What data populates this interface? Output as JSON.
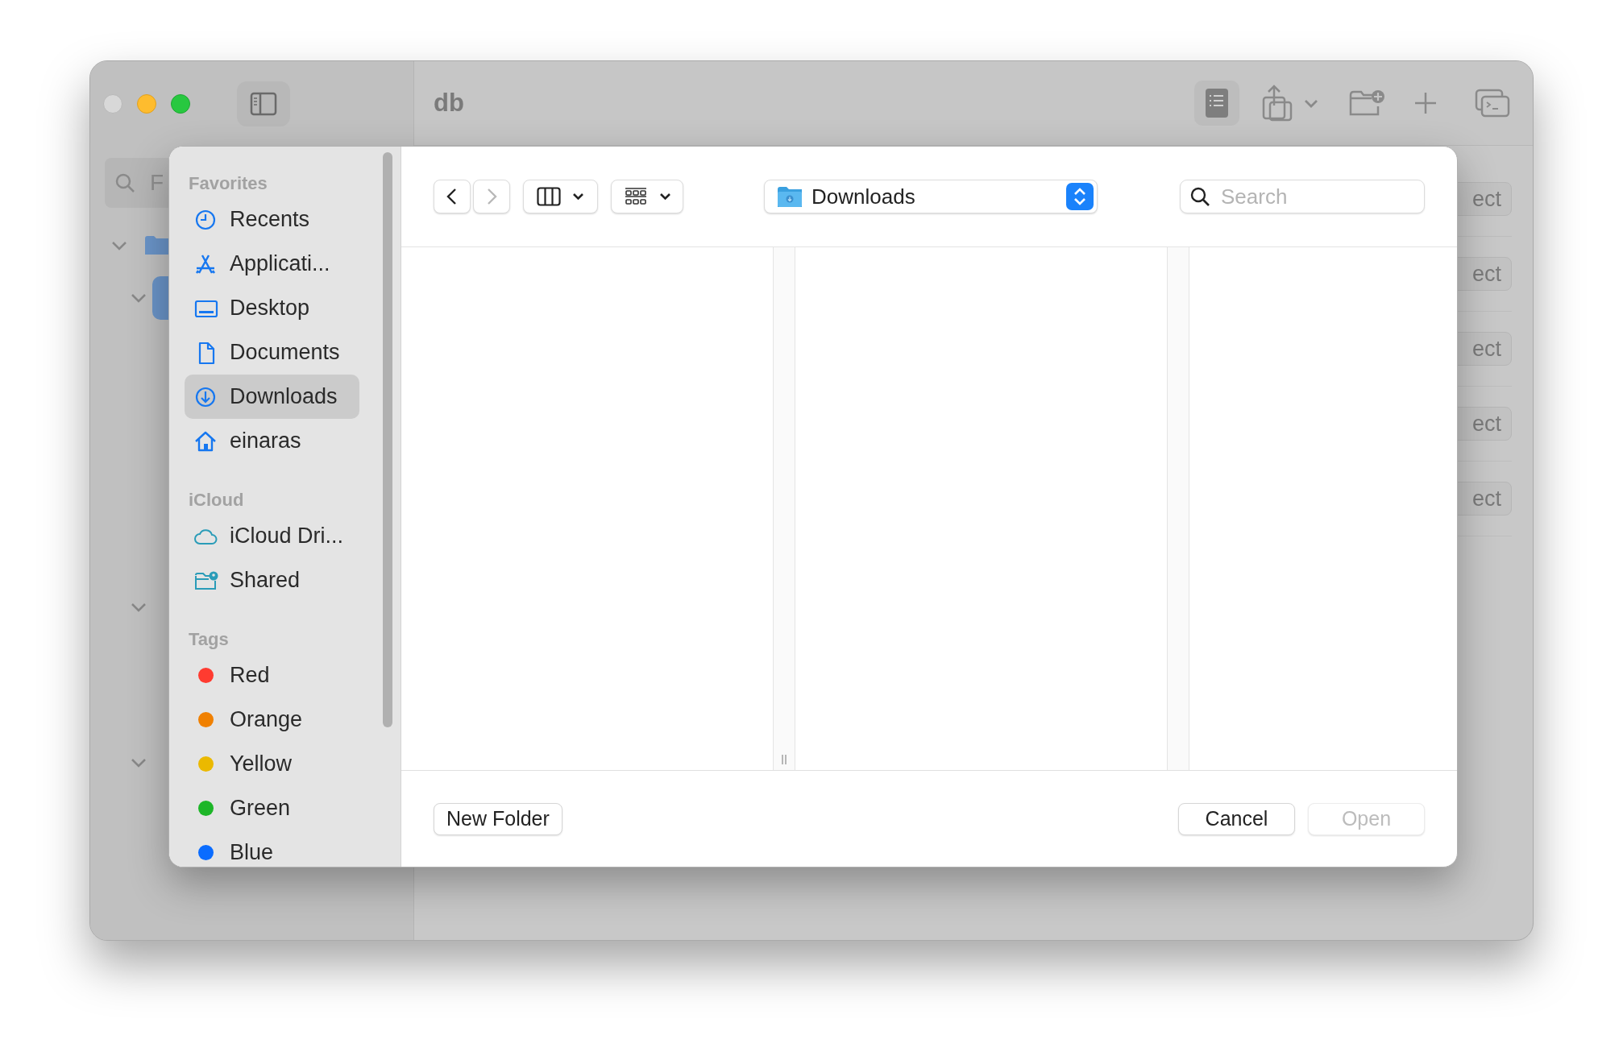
{
  "window": {
    "title": "db"
  },
  "background": {
    "search_text": "F",
    "row_buttons": [
      "ect",
      "ect",
      "ect",
      "ect",
      "ect"
    ]
  },
  "dialog": {
    "navigation": [
      {
        "disabled": false
      },
      {
        "disabled": true
      }
    ],
    "location": "Downloads",
    "search": {
      "placeholder": "Search"
    },
    "sidebar": [
      {
        "title": "Favorites",
        "kind": "places",
        "items": [
          {
            "label": "Recents",
            "selected": false
          },
          {
            "label": "Applicati...",
            "selected": false
          },
          {
            "label": "Desktop",
            "selected": false
          },
          {
            "label": "Documents",
            "selected": false
          },
          {
            "label": "Downloads",
            "selected": true
          },
          {
            "label": "einaras",
            "selected": false
          }
        ]
      },
      {
        "title": "iCloud",
        "kind": "cloud",
        "items": [
          {
            "label": "iCloud Dri...",
            "selected": false
          },
          {
            "label": "Shared",
            "selected": false
          }
        ]
      },
      {
        "title": "Tags",
        "kind": "tags",
        "items": [
          {
            "label": "Red",
            "color": "#ff3b30",
            "selected": false
          },
          {
            "label": "Orange",
            "color": "#f08000",
            "selected": false
          },
          {
            "label": "Yellow",
            "color": "#ebb900",
            "selected": false
          },
          {
            "label": "Green",
            "color": "#1db628",
            "selected": false
          },
          {
            "label": "Blue",
            "color": "#0a6cff",
            "selected": false
          }
        ]
      }
    ],
    "buttons": [
      {
        "label": "New Folder",
        "disabled": false
      },
      {
        "label": "Cancel",
        "disabled": false
      },
      {
        "label": "Open",
        "disabled": true
      }
    ]
  }
}
